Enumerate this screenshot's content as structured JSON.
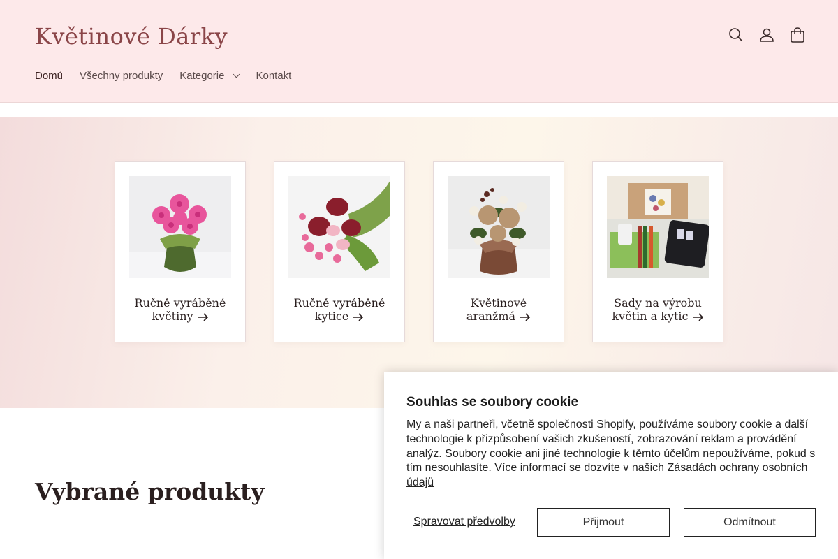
{
  "header": {
    "logo": "Květinové Dárky",
    "nav": {
      "home": "Domů",
      "all_products": "Všechny produkty",
      "categories": "Kategorie",
      "contact": "Kontakt"
    },
    "icons": [
      "search-icon",
      "account-icon",
      "cart-icon"
    ]
  },
  "collections": [
    {
      "line1": "Ručně vyráběné",
      "line2": "květiny"
    },
    {
      "line1": "Ručně vyráběné",
      "line2": "kytice"
    },
    {
      "line1": "Květinové",
      "line2": "aranžmá"
    },
    {
      "line1": "Sady na výrobu",
      "line2": "květin a kytic"
    }
  ],
  "featured": {
    "title": "Vybrané produkty"
  },
  "cookie": {
    "title": "Souhlas se soubory cookie",
    "text": "My a naši partneři, včetně společnosti Shopify, používáme soubory cookie a další technologie k přizpůsobení vašich zkušeností, zobrazování reklam a provádění analýz. Soubory cookie ani jiné technologie k těmto účelům nepoužíváme, pokud s tím nesouhlasíte. Více informací se dozvíte v našich",
    "link": "Zásadách ochrany osobních údajů",
    "manage": "Spravovat předvolby",
    "accept": "Přijmout",
    "decline": "Odmítnout"
  },
  "colors": {
    "header_bg": "#fde9ea",
    "logo": "#8a4548"
  }
}
